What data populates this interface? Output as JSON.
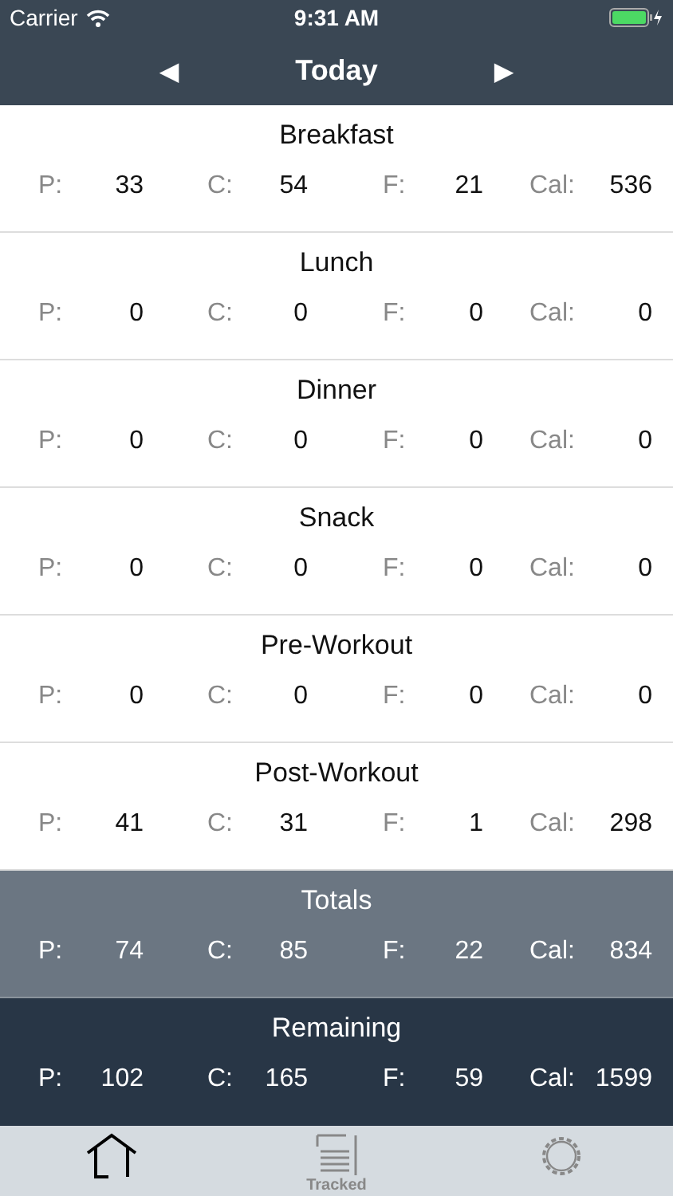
{
  "status_bar": {
    "carrier": "Carrier",
    "time": "9:31 AM"
  },
  "header": {
    "prev": "◀",
    "title": "Today",
    "next": "▶"
  },
  "sections": [
    {
      "kind": "meal",
      "title": "Breakfast",
      "macros": [
        {
          "label": "P:",
          "value": "33"
        },
        {
          "label": "C:",
          "value": "54"
        },
        {
          "label": "F:",
          "value": "21"
        },
        {
          "label": "Cal:",
          "value": "536"
        }
      ]
    },
    {
      "kind": "meal",
      "title": "Lunch",
      "macros": [
        {
          "label": "P:",
          "value": "0"
        },
        {
          "label": "C:",
          "value": "0"
        },
        {
          "label": "F:",
          "value": "0"
        },
        {
          "label": "Cal:",
          "value": "0"
        }
      ]
    },
    {
      "kind": "meal",
      "title": "Dinner",
      "macros": [
        {
          "label": "P:",
          "value": "0"
        },
        {
          "label": "C:",
          "value": "0"
        },
        {
          "label": "F:",
          "value": "0"
        },
        {
          "label": "Cal:",
          "value": "0"
        }
      ]
    },
    {
      "kind": "meal",
      "title": "Snack",
      "macros": [
        {
          "label": "P:",
          "value": "0"
        },
        {
          "label": "C:",
          "value": "0"
        },
        {
          "label": "F:",
          "value": "0"
        },
        {
          "label": "Cal:",
          "value": "0"
        }
      ]
    },
    {
      "kind": "meal",
      "title": "Pre-Workout",
      "macros": [
        {
          "label": "P:",
          "value": "0"
        },
        {
          "label": "C:",
          "value": "0"
        },
        {
          "label": "F:",
          "value": "0"
        },
        {
          "label": "Cal:",
          "value": "0"
        }
      ]
    },
    {
      "kind": "meal",
      "title": "Post-Workout",
      "macros": [
        {
          "label": "P:",
          "value": "41"
        },
        {
          "label": "C:",
          "value": "31"
        },
        {
          "label": "F:",
          "value": "1"
        },
        {
          "label": "Cal:",
          "value": "298"
        }
      ]
    },
    {
      "kind": "totals",
      "title": "Totals",
      "macros": [
        {
          "label": "P:",
          "value": "74"
        },
        {
          "label": "C:",
          "value": "85"
        },
        {
          "label": "F:",
          "value": "22"
        },
        {
          "label": "Cal:",
          "value": "834"
        }
      ]
    },
    {
      "kind": "remaining",
      "title": "Remaining",
      "macros": [
        {
          "label": "P:",
          "value": "102"
        },
        {
          "label": "C:",
          "value": "165"
        },
        {
          "label": "F:",
          "value": "59"
        },
        {
          "label": "Cal:",
          "value": "1599"
        }
      ]
    }
  ],
  "tabs": [
    {
      "kind": "home",
      "selected": true
    },
    {
      "kind": "tracked",
      "label": "Tracked",
      "selected": false
    },
    {
      "kind": "settings",
      "selected": false
    }
  ]
}
